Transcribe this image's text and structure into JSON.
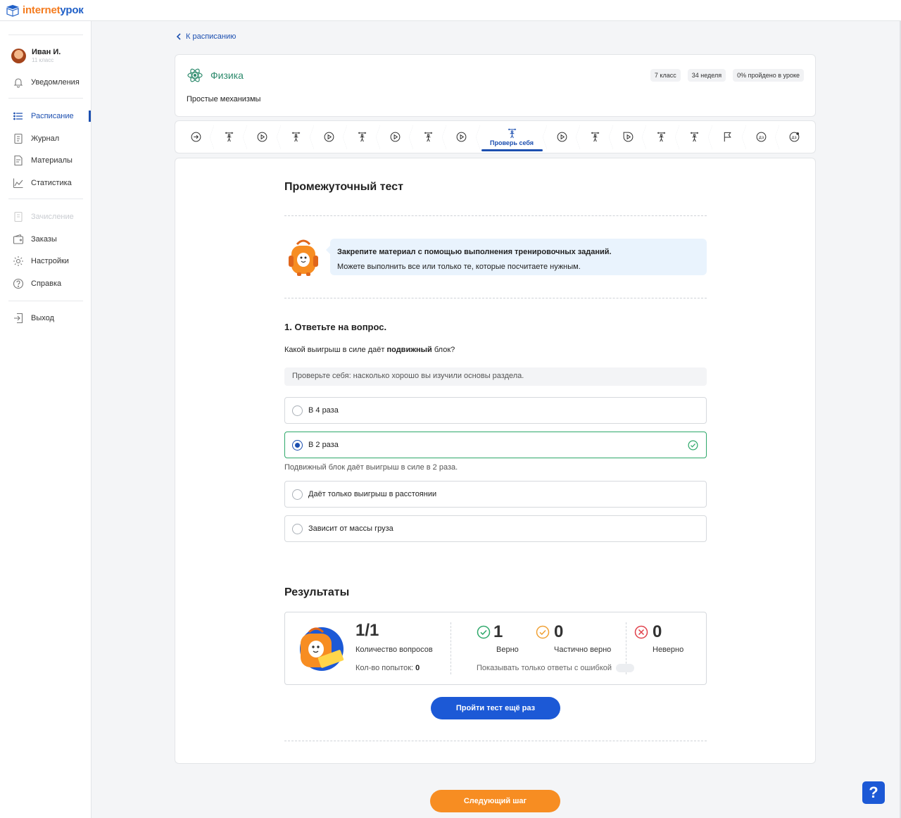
{
  "app": {
    "logo_part1": "internet",
    "logo_part2": "урок"
  },
  "user": {
    "name": "Иван И.",
    "grade": "11 класс"
  },
  "sidebar": {
    "items": [
      {
        "label": "Уведомления"
      },
      {
        "label": "Расписание"
      },
      {
        "label": "Журнал"
      },
      {
        "label": "Материалы"
      },
      {
        "label": "Статистика"
      },
      {
        "label": "Зачисление"
      },
      {
        "label": "Заказы"
      },
      {
        "label": "Настройки"
      },
      {
        "label": "Справка"
      },
      {
        "label": "Выход"
      }
    ]
  },
  "breadcrumb": {
    "back_label": "К расписанию"
  },
  "subject": {
    "name": "Физика",
    "topic": "Простые механизмы",
    "chips": [
      "7 класс",
      "34 неделя",
      "0% пройдено в уроке"
    ]
  },
  "steps": {
    "active_label": "Проверь себя"
  },
  "test": {
    "title": "Промежуточный тест",
    "intro_bold": "Закрепите материал с помощью выполнения тренировочных заданий.",
    "intro_text": "Можете выполнить все или только те, которые посчитаете нужным.",
    "question_title": "1. Ответьте на вопрос.",
    "question_part1": "Какой выигрыш в силе даёт ",
    "question_bold": "подвижный",
    "question_part2": " блок?",
    "hint": "Проверьте себя: насколько хорошо вы изучили основы раздела.",
    "options": [
      {
        "label": "В 4 раза"
      },
      {
        "label": "В 2 раза",
        "selected": true,
        "correct": true
      },
      {
        "label": "Даёт только выигрыш в расстоянии"
      },
      {
        "label": "Зависит от массы груза"
      }
    ],
    "explanation": "Подвижный блок даёт выигрыш в силе в 2 раза."
  },
  "results": {
    "title": "Результаты",
    "questions_value": "1/1",
    "questions_label": "Количество вопросов",
    "attempts_label": "Кол-во попыток:",
    "attempts_value": "0",
    "correct_value": "1",
    "correct_label": "Верно",
    "partial_value": "0",
    "partial_label": "Частично верно",
    "wrong_value": "0",
    "wrong_label": "Неверно",
    "errors_only_label": "Показывать только ответы с ошибкой",
    "retry_button": "Пройти тест ещё раз"
  },
  "footer": {
    "next_button": "Следующий шаг",
    "help_label": "?"
  },
  "colors": {
    "accent_blue": "#1c59d6",
    "accent_orange": "#f78d22",
    "success_green": "#2ea86a",
    "subject_green": "#2e8b6d"
  }
}
